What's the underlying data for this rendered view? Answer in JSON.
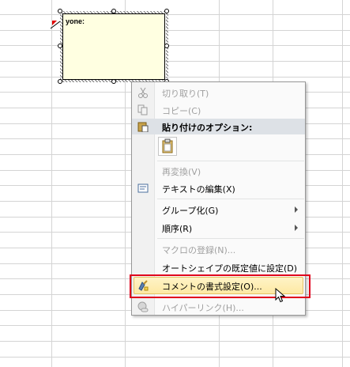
{
  "comment": {
    "author_text": "yone:"
  },
  "menu": {
    "cut": "切り取り(T)",
    "copy": "コピー(C)",
    "paste_options_header": "貼り付けのオプション:",
    "reconvert": "再変換(V)",
    "edit_text": "テキストの編集(X)",
    "group": "グループ化(G)",
    "order": "順序(R)",
    "assign_macro": "マクロの登録(N)...",
    "set_autoshape_default": "オートシェイプの既定値に設定(D)",
    "format_comment": "コメントの書式設定(O)...",
    "hyperlink": "ハイパーリンク(H)..."
  },
  "colors": {
    "comment_fill": "#ffffe1",
    "highlight_border": "#e0001c",
    "menu_hover": "#fde9a4"
  }
}
